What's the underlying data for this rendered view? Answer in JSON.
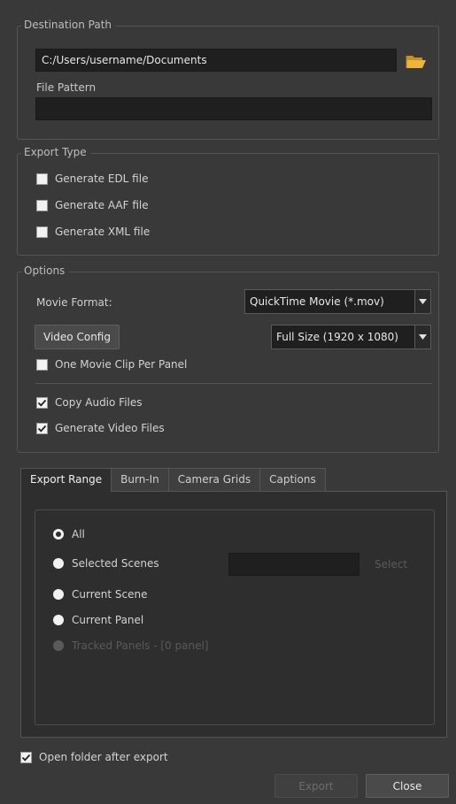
{
  "destination": {
    "group_title": "Destination Path",
    "path_value": "C:/Users/username/Documents",
    "file_pattern_label": "File Pattern",
    "file_pattern_value": ""
  },
  "export_type": {
    "group_title": "Export Type",
    "items": [
      {
        "label": "Generate EDL file",
        "checked": false
      },
      {
        "label": "Generate AAF file",
        "checked": false
      },
      {
        "label": "Generate XML file",
        "checked": false
      }
    ]
  },
  "options": {
    "group_title": "Options",
    "movie_format_label": "Movie Format:",
    "movie_format_value": "QuickTime Movie (*.mov)",
    "video_config_label": "Video Config",
    "resolution_value": "Full Size (1920 x 1080)",
    "one_clip_label": "One Movie Clip Per Panel",
    "one_clip_checked": false,
    "copy_audio_label": "Copy Audio Files",
    "copy_audio_checked": true,
    "generate_video_label": "Generate Video Files",
    "generate_video_checked": true
  },
  "tabs": [
    {
      "label": "Export Range",
      "active": true
    },
    {
      "label": "Burn-In",
      "active": false
    },
    {
      "label": "Camera Grids",
      "active": false
    },
    {
      "label": "Captions",
      "active": false
    }
  ],
  "export_range": {
    "all_label": "All",
    "selected_scenes_label": "Selected Scenes",
    "select_button_label": "Select",
    "current_scene_label": "Current Scene",
    "current_panel_label": "Current Panel",
    "tracked_panels_label": "Tracked Panels - [0 panel]"
  },
  "footer": {
    "open_folder_label": "Open folder after export",
    "open_folder_checked": true,
    "export_label": "Export",
    "close_label": "Close"
  },
  "colors": {
    "background": "#393939",
    "field": "#1f1f1f",
    "folder_icon": "#f0b43c"
  }
}
